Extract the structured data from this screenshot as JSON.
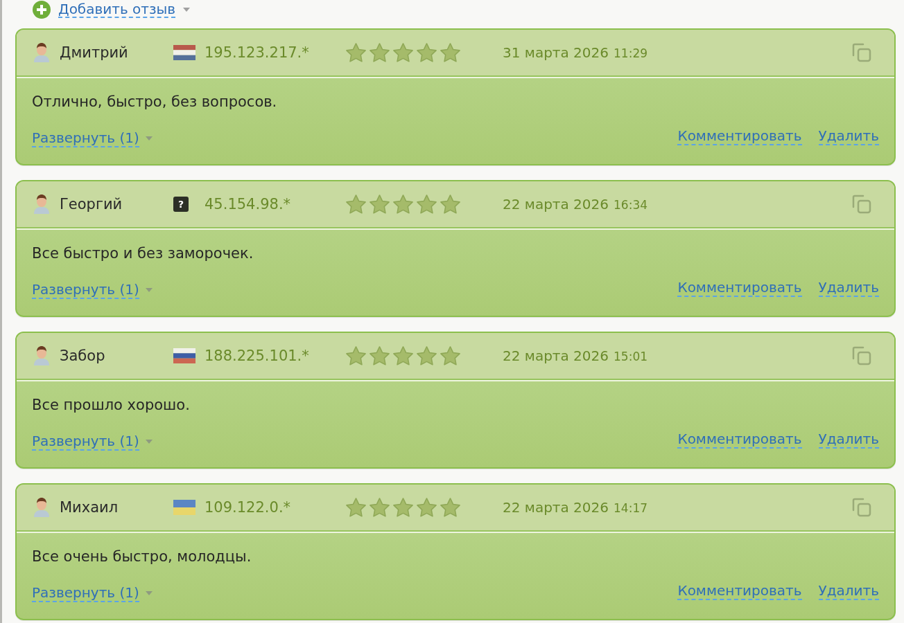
{
  "add_review": {
    "label": "Добавить отзыв"
  },
  "reviews": [
    {
      "author": "Дмитрий",
      "flag": {
        "kind": "nl"
      },
      "ip": "195.123.217.*",
      "stars": 5,
      "date": "31 марта 2026",
      "time": "11:29",
      "text": "Отлично, быстро, без вопросов.",
      "expand": "Развернуть (1)",
      "actions": [
        "Комментировать",
        "Удалить"
      ]
    },
    {
      "author": "Георгий",
      "flag": {
        "kind": "unknown",
        "label": "?"
      },
      "ip": "45.154.98.*",
      "stars": 5,
      "date": "22 марта 2026",
      "time": "16:34",
      "text": "Все быстро и без заморочек.",
      "expand": "Развернуть (1)",
      "actions": [
        "Комментировать",
        "Удалить"
      ]
    },
    {
      "author": "Забор",
      "flag": {
        "kind": "ru"
      },
      "ip": "188.225.101.*",
      "stars": 5,
      "date": "22 марта 2026",
      "time": "15:01",
      "text": "Все прошло хорошо.",
      "expand": "Развернуть (1)",
      "actions": [
        "Комментировать",
        "Удалить"
      ]
    },
    {
      "author": "Михаил",
      "flag": {
        "kind": "ua"
      },
      "ip": "109.122.0.*",
      "stars": 5,
      "date": "22 марта 2026",
      "time": "14:17",
      "text": "Все очень быстро, молодцы.",
      "expand": "Развернуть (1)",
      "actions": [
        "Комментировать",
        "Удалить"
      ]
    }
  ]
}
